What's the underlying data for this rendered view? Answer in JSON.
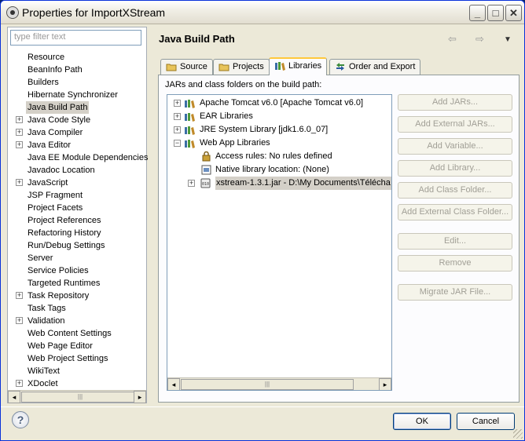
{
  "window": {
    "title": "Properties for ImportXStream",
    "minimize": "_",
    "maximize": "□",
    "close": "✕"
  },
  "filter": {
    "placeholder": "type filter text"
  },
  "left_tree": [
    {
      "label": "Resource",
      "expandable": false
    },
    {
      "label": "BeanInfo Path",
      "expandable": false
    },
    {
      "label": "Builders",
      "expandable": false
    },
    {
      "label": "Hibernate Synchronizer",
      "expandable": false
    },
    {
      "label": "Java Build Path",
      "expandable": false,
      "selected": true
    },
    {
      "label": "Java Code Style",
      "expandable": true
    },
    {
      "label": "Java Compiler",
      "expandable": true
    },
    {
      "label": "Java Editor",
      "expandable": true
    },
    {
      "label": "Java EE Module Dependencies",
      "expandable": false
    },
    {
      "label": "Javadoc Location",
      "expandable": false
    },
    {
      "label": "JavaScript",
      "expandable": true
    },
    {
      "label": "JSP Fragment",
      "expandable": false
    },
    {
      "label": "Project Facets",
      "expandable": false
    },
    {
      "label": "Project References",
      "expandable": false
    },
    {
      "label": "Refactoring History",
      "expandable": false
    },
    {
      "label": "Run/Debug Settings",
      "expandable": false
    },
    {
      "label": "Server",
      "expandable": false
    },
    {
      "label": "Service Policies",
      "expandable": false
    },
    {
      "label": "Targeted Runtimes",
      "expandable": false
    },
    {
      "label": "Task Repository",
      "expandable": true
    },
    {
      "label": "Task Tags",
      "expandable": false
    },
    {
      "label": "Validation",
      "expandable": true
    },
    {
      "label": "Web Content Settings",
      "expandable": false
    },
    {
      "label": "Web Page Editor",
      "expandable": false
    },
    {
      "label": "Web Project Settings",
      "expandable": false
    },
    {
      "label": "WikiText",
      "expandable": false
    },
    {
      "label": "XDoclet",
      "expandable": true
    }
  ],
  "page": {
    "title": "Java Build Path",
    "back": "⇦",
    "forward": "⇨",
    "menu": "▼"
  },
  "tabs": [
    {
      "label": "Source",
      "active": false
    },
    {
      "label": "Projects",
      "active": false
    },
    {
      "label": "Libraries",
      "active": true
    },
    {
      "label": "Order and Export",
      "active": false
    }
  ],
  "libraries": {
    "label": "JARs and class folders on the build path:",
    "entries": [
      {
        "text": "Apache Tomcat v6.0 [Apache Tomcat v6.0]",
        "expander": "+"
      },
      {
        "text": "EAR Libraries",
        "expander": "+"
      },
      {
        "text": "JRE System Library [jdk1.6.0_07]",
        "expander": "+"
      },
      {
        "text": "Web App Libraries",
        "expander": "−"
      },
      {
        "text": "Access rules: No rules defined"
      },
      {
        "text": "Native library location: (None)"
      },
      {
        "text": "xstream-1.3.1.jar - D:\\My Documents\\Télécha",
        "expander": "+",
        "selected": true
      }
    ]
  },
  "buttons": {
    "add_jars": "Add JARs...",
    "add_external_jars": "Add External JARs...",
    "add_variable": "Add Variable...",
    "add_library": "Add Library...",
    "add_class_folder": "Add Class Folder...",
    "add_external_class_folder": "Add External Class Folder...",
    "edit": "Edit...",
    "remove": "Remove",
    "migrate_jar": "Migrate JAR File..."
  },
  "footer": {
    "help": "?",
    "ok": "OK",
    "cancel": "Cancel"
  },
  "scroll": {
    "left": "◂",
    "right": "▸",
    "grip": "|||"
  }
}
